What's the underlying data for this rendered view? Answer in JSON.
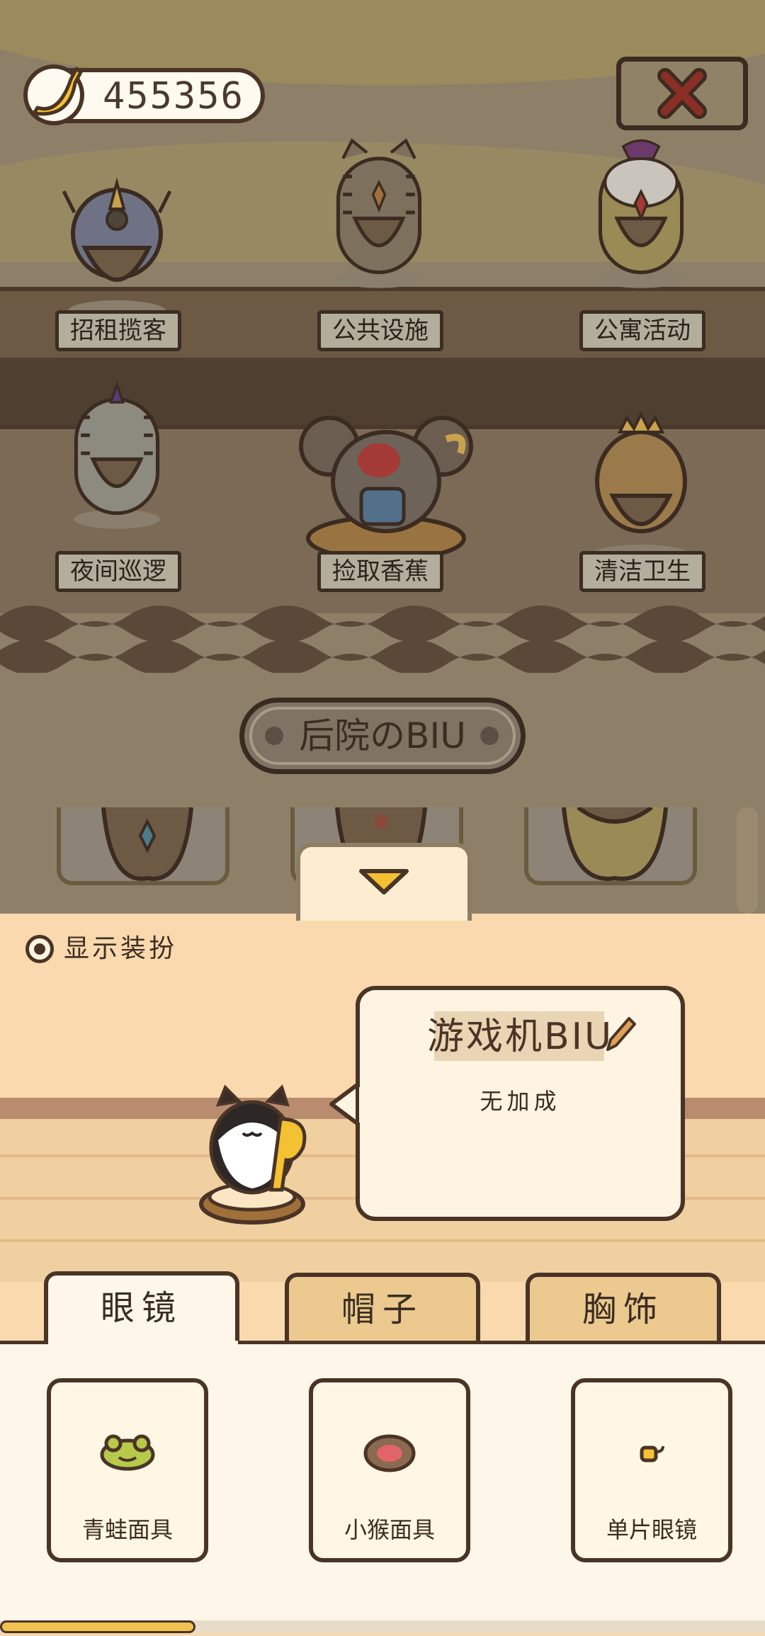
{
  "currency": {
    "icon": "banana-icon",
    "amount": "455356"
  },
  "close_button": {
    "icon": "close-x-icon",
    "color": "#c0392b"
  },
  "statues": [
    {
      "label": "招租揽客"
    },
    {
      "label": "公共设施"
    },
    {
      "label": "公寓活动"
    },
    {
      "label": "夜间巡逻"
    },
    {
      "label": "捡取香蕉"
    },
    {
      "label": "清洁卫生"
    }
  ],
  "backyard": {
    "title": "后院のBIU"
  },
  "collapse_arrow": {
    "icon": "triangle-down-icon",
    "color": "#f3c132"
  },
  "toggle": {
    "label": "显示装扮",
    "state": "selected"
  },
  "character": {
    "name": "游戏机BIU",
    "bonus": "无加成",
    "edit_icon": "pencil-icon"
  },
  "tabs": [
    {
      "label": "眼镜",
      "active": true
    },
    {
      "label": "帽子",
      "active": false
    },
    {
      "label": "胸饰",
      "active": false
    }
  ],
  "items": [
    {
      "label": "青蛙面具",
      "icon": "frog-mask-icon"
    },
    {
      "label": "小猴面具",
      "icon": "monkey-mask-icon"
    },
    {
      "label": "单片眼镜",
      "icon": "monocle-icon"
    }
  ],
  "colors": {
    "accent": "#f3c132",
    "outline": "#4a3426",
    "panel": "#f9d9ad"
  }
}
